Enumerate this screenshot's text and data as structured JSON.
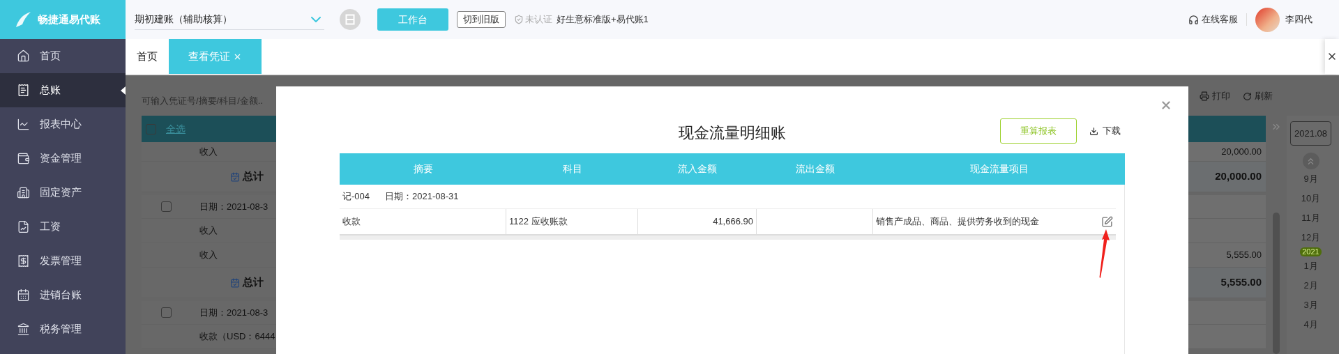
{
  "top_bar": {
    "logo_text": "畅捷通易代账",
    "account_select": "期初建账（辅助核算）",
    "workbench_button": "工作台",
    "old_version_button": "切到旧版",
    "certification": "未认证",
    "edition": "好生意标准版+易代账1",
    "support": "在线客服",
    "user_name": "李四代"
  },
  "sidebar": {
    "items": [
      {
        "label": "首页",
        "selected": false
      },
      {
        "label": "总账",
        "selected": true
      },
      {
        "label": "报表中心",
        "selected": false
      },
      {
        "label": "资金管理",
        "selected": false
      },
      {
        "label": "固定资产",
        "selected": false
      },
      {
        "label": "工资",
        "selected": false
      },
      {
        "label": "发票管理",
        "selected": false
      },
      {
        "label": "进销台账",
        "selected": false
      },
      {
        "label": "税务管理",
        "selected": false
      }
    ]
  },
  "tabs": [
    {
      "label": "首页",
      "selected": false,
      "closable": false
    },
    {
      "label": "查看凭证",
      "selected": true,
      "closable": true
    }
  ],
  "background": {
    "search_placeholder": "可输入凭证号/摘要/科目/金额..",
    "select_all": {
      "label": "全选",
      "checked": false
    },
    "print_button": "打印",
    "refresh_button": "刷新",
    "rows": [
      {
        "kind": "entry",
        "text": "收入",
        "amount": "20,000.00"
      },
      {
        "kind": "total",
        "text": "总计",
        "amount": "20,000.00"
      },
      {
        "kind": "date",
        "text": "日期：2021-08-3",
        "checked": false
      },
      {
        "kind": "entry",
        "text": "收入"
      },
      {
        "kind": "entry",
        "text": "收入",
        "amount": "5,555.00"
      },
      {
        "kind": "total",
        "text": "总计",
        "amount": "5,555.00"
      },
      {
        "kind": "date",
        "text": "日期：2021-08-3",
        "checked": false
      },
      {
        "kind": "entry",
        "text": "收款（USD：6444"
      }
    ],
    "timeline": {
      "current": "2021.08",
      "items": [
        {
          "kind": "month",
          "label": "9月"
        },
        {
          "kind": "month",
          "label": "10月"
        },
        {
          "kind": "month",
          "label": "11月"
        },
        {
          "kind": "month",
          "label": "12月"
        },
        {
          "kind": "year",
          "label": "2021"
        },
        {
          "kind": "month",
          "label": "1月"
        },
        {
          "kind": "month",
          "label": "2月"
        },
        {
          "kind": "month",
          "label": "3月"
        },
        {
          "kind": "month",
          "label": "4月"
        }
      ]
    }
  },
  "dialog": {
    "title": "现金流量明细账",
    "recalc_button": "重算报表",
    "download_button": "下载",
    "columns": [
      "摘要",
      "科目",
      "流入金额",
      "流出金额",
      "现金流量项目"
    ],
    "groups": [
      {
        "voucher": "记-004",
        "date": "日期：2021-08-31",
        "rows": [
          {
            "summary": "收款",
            "account": "1122 应收账款",
            "inflow": "41,666.90",
            "cash_flow_item": "销售产成品、商品、提供劳务收到的现金"
          }
        ]
      }
    ]
  }
}
